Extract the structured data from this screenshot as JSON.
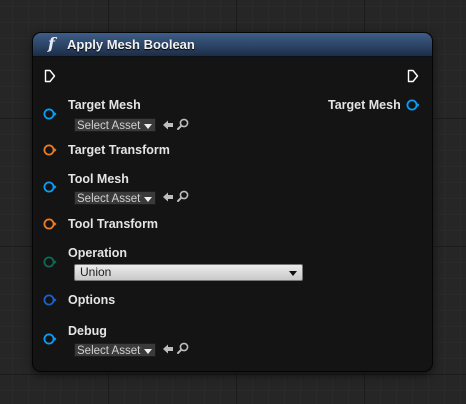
{
  "node": {
    "title": "Apply Mesh Boolean",
    "icon": "function-icon"
  },
  "pins": {
    "target_mesh": {
      "label": "Target Mesh",
      "asset_value": "Select Asset"
    },
    "target_transform": {
      "label": "Target Transform"
    },
    "tool_mesh": {
      "label": "Tool Mesh",
      "asset_value": "Select Asset"
    },
    "tool_transform": {
      "label": "Tool Transform"
    },
    "operation": {
      "label": "Operation",
      "value": "Union"
    },
    "options": {
      "label": "Options"
    },
    "debug": {
      "label": "Debug",
      "asset_value": "Select Asset"
    },
    "output_target_mesh": {
      "label": "Target Mesh"
    }
  },
  "colors": {
    "object_pin": "#00a0ff",
    "struct_pin": "#f07c1e",
    "enum_pin": "#0d6b53",
    "options_pin": "#1f5fd0"
  }
}
